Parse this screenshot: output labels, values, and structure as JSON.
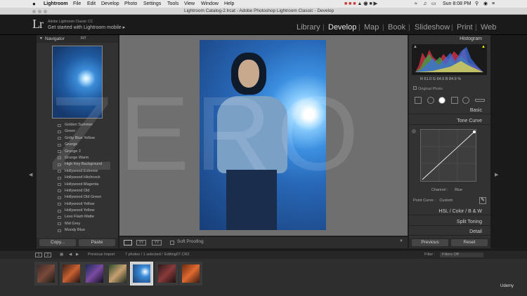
{
  "menubar": {
    "apple": "",
    "app": "Lightroom",
    "items": [
      "File",
      "Edit",
      "Develop",
      "Photo",
      "Settings",
      "Tools",
      "View",
      "Window",
      "Help"
    ],
    "clock": "Sun 8:08 PM"
  },
  "window": {
    "title": "Lightroom Catalog-2.lrcat - Adobe Photoshop Lightroom Classic - Develop"
  },
  "identity": {
    "logo": "Lr",
    "product": "Adobe Lightroom Classic CC",
    "mobile": "Get started with Lightroom mobile ▸"
  },
  "modules": [
    "Library",
    "Develop",
    "Map",
    "Book",
    "Slideshow",
    "Print",
    "Web"
  ],
  "active_module": "Develop",
  "left_panel": {
    "navigator": "Navigator",
    "fit": "FIT",
    "presets": [
      "Golden Summer",
      "Green",
      "Gritty Blue Yellow",
      "Grunge",
      "Grunge 2",
      "Grunge Warm",
      "High Key Background",
      "Hollywood Extreme",
      "Hollywood Hitchcock",
      "Hollywood Magenta",
      "Hollywood Old",
      "Hollywood Old Green",
      "Hollywood Yellow",
      "Hollywood Yellow",
      "Less Flash Matte",
      "Mid Grey",
      "Moody Blue"
    ],
    "copy": "Copy...",
    "paste": "Paste"
  },
  "watermark": "ZERO",
  "toolbar": {
    "soft_proofing": "Soft Proofing"
  },
  "right_panel": {
    "histogram": "Histogram",
    "readout_r": "R",
    "readout_r_val": "61.0",
    "readout_g": "G",
    "readout_g_val": "64.6",
    "readout_b": "B",
    "readout_b_val": "84.9",
    "pct": "%",
    "original": "Original Photo",
    "basic": "Basic",
    "tone_curve": "Tone Curve",
    "channel": "Channel :",
    "channel_value": "Blue",
    "point_curve": "Point Curve :",
    "point_curve_value": "Custom",
    "hsl": "HSL / Color / B & W",
    "split_toning": "Split Toning",
    "detail": "Detail",
    "previous": "Previous",
    "reset": "Reset"
  },
  "filmstrip": {
    "pages": [
      "1",
      "2"
    ],
    "source": "Previous Import",
    "info": "7 photos / 1 selected /",
    "file": "Editing07.CR2",
    "filter_label": "Filter :",
    "filter_value": "Filters Off"
  },
  "udemy": "Udemy"
}
